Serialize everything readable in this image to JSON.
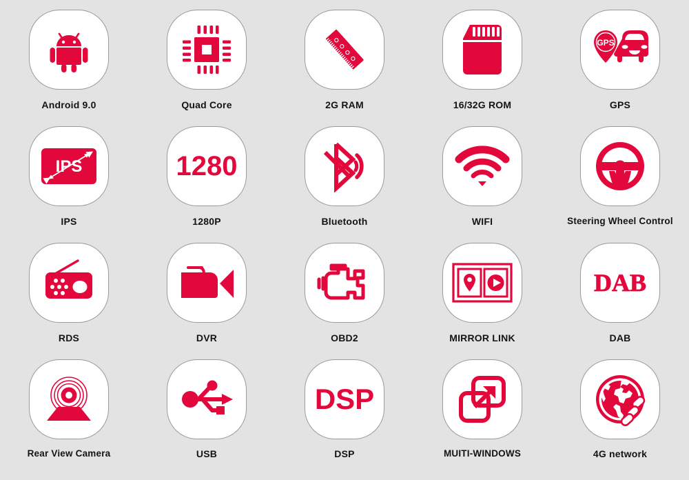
{
  "page": {
    "background_color": "#e3e3e3",
    "accent_color": "#e2083c",
    "tile_color": "#ffffff",
    "tile_border_color": "#9a9a9a",
    "label_color": "#141414",
    "columns": 5,
    "rows": 4
  },
  "features": [
    {
      "label": "Android 9.0",
      "icon": "android-robot-icon"
    },
    {
      "label": "Quad Core",
      "icon": "cpu-chip-icon"
    },
    {
      "label": "2G RAM",
      "icon": "ram-stick-ruler-icon"
    },
    {
      "label": "16/32G ROM",
      "icon": "memory-card-icon"
    },
    {
      "label": "GPS",
      "icon": "gps-pin-car-icon",
      "icon_text": "GPS"
    },
    {
      "label": "IPS",
      "icon": "ips-screen-diagonal-icon",
      "icon_text": "IPS"
    },
    {
      "label": "1280P",
      "icon": "resolution-number-icon",
      "icon_text": "1280"
    },
    {
      "label": "Bluetooth",
      "icon": "bluetooth-icon"
    },
    {
      "label": "WIFI",
      "icon": "wifi-icon"
    },
    {
      "label": "Steering Wheel Control",
      "icon": "steering-wheel-icon"
    },
    {
      "label": "RDS",
      "icon": "radio-icon"
    },
    {
      "label": "DVR",
      "icon": "video-camera-icon"
    },
    {
      "label": "OBD2",
      "icon": "engine-check-icon"
    },
    {
      "label": "MIRROR LINK",
      "icon": "mirror-link-screens-icon"
    },
    {
      "label": "DAB",
      "icon": "dab-text-icon",
      "icon_text": "DAB"
    },
    {
      "label": "Rear View Camera",
      "icon": "rear-view-camera-icon"
    },
    {
      "label": "USB",
      "icon": "usb-icon"
    },
    {
      "label": "DSP",
      "icon": "dsp-text-icon",
      "icon_text": "DSP"
    },
    {
      "label": "MUITI-WINDOWS",
      "icon": "multi-window-icon"
    },
    {
      "label": "4G network",
      "icon": "globe-chain-icon"
    }
  ]
}
